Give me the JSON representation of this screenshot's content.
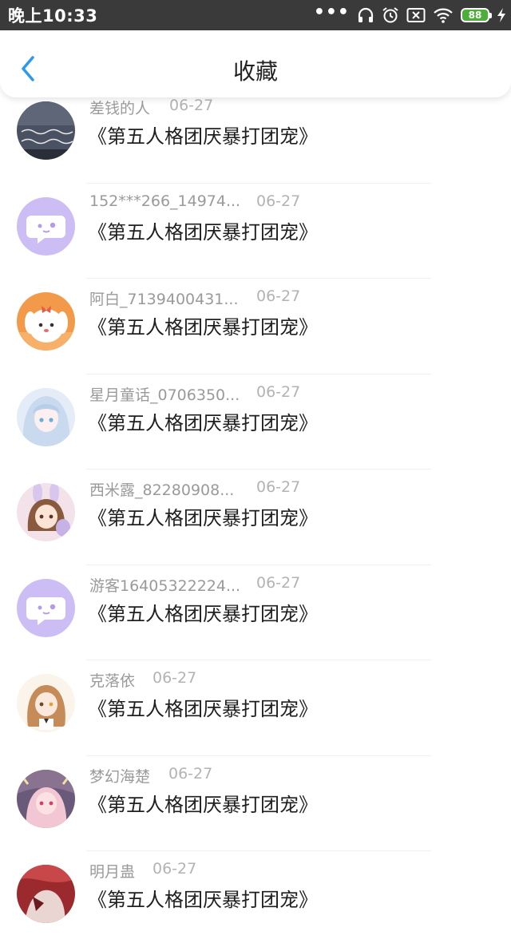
{
  "status_bar": {
    "time": "晚上10:33",
    "battery": "88",
    "icons": [
      "more-dots-icon",
      "headset-icon",
      "alarm-icon",
      "sim-off-icon",
      "wifi-icon",
      "battery-icon",
      "charging-icon"
    ]
  },
  "header": {
    "back_icon": "chevron-left-icon",
    "title": "收藏"
  },
  "colors": {
    "accent": "#2a9af0",
    "status_bar_bg": "#3a3a3a",
    "battery_fill": "#4caf3a"
  },
  "items": [
    {
      "user": "差钱的人",
      "date": "06-27",
      "title": "《第五人格团厌暴打团宠》"
    },
    {
      "user": "152***266_14974...",
      "date": "06-27",
      "title": "《第五人格团厌暴打团宠》"
    },
    {
      "user": "阿白_7139400431...",
      "date": "06-27",
      "title": "《第五人格团厌暴打团宠》"
    },
    {
      "user": "星月童话_0706350...",
      "date": "06-27",
      "title": "《第五人格团厌暴打团宠》"
    },
    {
      "user": "西米露_82280908...",
      "date": "06-27",
      "title": "《第五人格团厌暴打团宠》"
    },
    {
      "user": "游客16405322224...",
      "date": "06-27",
      "title": "《第五人格团厌暴打团宠》"
    },
    {
      "user": "克落依",
      "date": "06-27",
      "title": "《第五人格团厌暴打团宠》"
    },
    {
      "user": "梦幻海楚",
      "date": "06-27",
      "title": "《第五人格团厌暴打团宠》"
    },
    {
      "user": "明月蛊",
      "date": "06-27",
      "title": "《第五人格团厌暴打团宠》"
    }
  ]
}
